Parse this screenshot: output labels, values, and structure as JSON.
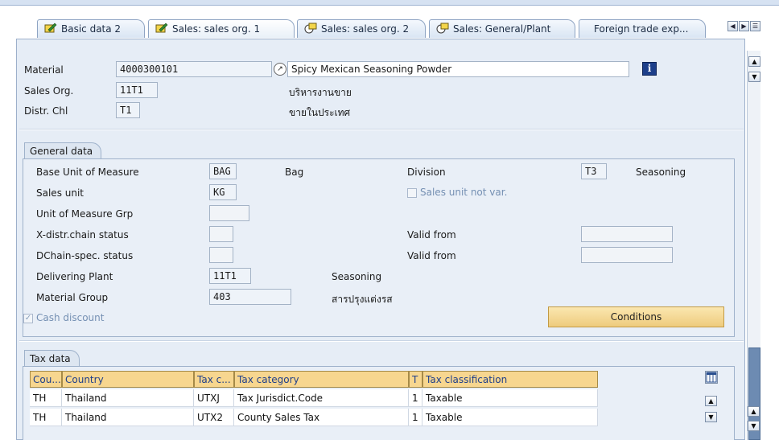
{
  "tabs": [
    {
      "label": "Basic data 2"
    },
    {
      "label": "Sales: sales org. 1"
    },
    {
      "label": "Sales: sales org. 2"
    },
    {
      "label": "Sales: General/Plant"
    },
    {
      "label": "Foreign trade exp..."
    }
  ],
  "tab_nav": {
    "left": "◀",
    "right": "▶",
    "list": "☰"
  },
  "header": {
    "material_label": "Material",
    "material_value": "4000300101",
    "material_desc": "Spicy Mexican Seasoning Powder",
    "sales_org_label": "Sales Org.",
    "sales_org_value": "11T1",
    "sales_org_desc": "บริหารงานขาย",
    "distr_chl_label": "Distr. Chl",
    "distr_chl_value": "T1",
    "distr_chl_desc": "ขายในประเทศ",
    "info_icon_glyph": "i"
  },
  "general": {
    "title": "General data",
    "base_uom_label": "Base Unit of Measure",
    "base_uom_value": "BAG",
    "base_uom_desc": "Bag",
    "division_label": "Division",
    "division_value": "T3",
    "division_desc": "Seasoning",
    "sales_unit_label": "Sales unit",
    "sales_unit_value": "KG",
    "sales_unit_not_var_label": "Sales unit not var.",
    "uom_grp_label": "Unit of Measure Grp",
    "uom_grp_value": "",
    "xdistr_label": "X-distr.chain status",
    "xdistr_value": "",
    "valid_from_label_1": "Valid from",
    "valid_from_value_1": "",
    "dchain_label": "DChain-spec. status",
    "dchain_value": "",
    "valid_from_label_2": "Valid from",
    "valid_from_value_2": "",
    "delivering_plant_label": "Delivering Plant",
    "delivering_plant_value": "11T1",
    "delivering_plant_desc": "Seasoning",
    "material_group_label": "Material Group",
    "material_group_value": "403",
    "material_group_desc": "สารปรุงแต่งรส",
    "cash_discount_label": "Cash discount",
    "cash_discount_checked": true,
    "conditions_button": "Conditions"
  },
  "tax": {
    "title": "Tax data",
    "columns": [
      "Cou...",
      "Country",
      "Tax c...",
      "Tax category",
      "T",
      "Tax classification"
    ],
    "rows": [
      {
        "country_code": "TH",
        "country": "Thailand",
        "tax_code": "UTXJ",
        "tax_category": "Tax Jurisdict.Code",
        "t": "1",
        "classification": "Taxable"
      },
      {
        "country_code": "TH",
        "country": "Thailand",
        "tax_code": "UTX2",
        "tax_category": "County Sales Tax",
        "t": "1",
        "classification": "Taxable"
      }
    ]
  },
  "scroll": {
    "up": "▲",
    "down": "▼"
  },
  "colors": {
    "accent_header": "#f7d68f",
    "button": "#f2d38c",
    "panel": "#e6edf6"
  }
}
